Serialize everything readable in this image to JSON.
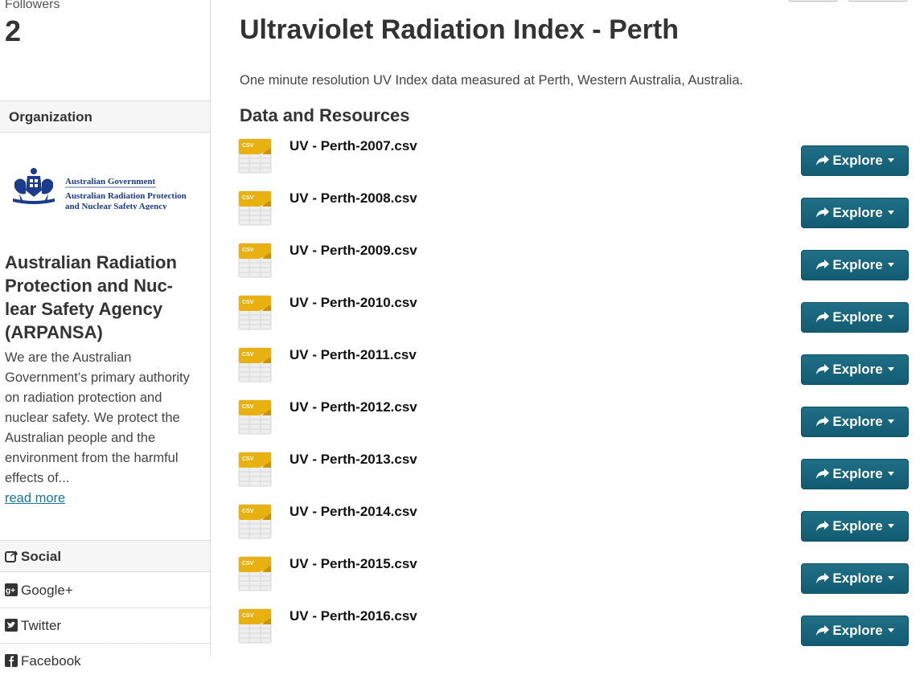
{
  "sidebar": {
    "followers": {
      "label": "Followers",
      "count": "2"
    },
    "organization": {
      "heading": "Organization",
      "logo_text": [
        "Australian Government",
        "Australian Radiation Protection",
        "and Nuclear Safety Agency"
      ],
      "name": "Australian Radiation Protection and Nuc-lear Safety Agency (ARPANSA)",
      "description": "We are the Australian Government’s primary authority on radiation protection and nuclear safety. We protect the Australian people and the environment from the harmful effects of...",
      "read_more": "read more"
    },
    "social": {
      "heading": "Social",
      "items": [
        {
          "label": "Google+",
          "icon": "google-plus-icon"
        },
        {
          "label": "Twitter",
          "icon": "twitter-icon"
        },
        {
          "label": "Facebook",
          "icon": "facebook-icon"
        }
      ]
    }
  },
  "main": {
    "title": "Ultraviolet Radiation Index - Perth",
    "notes": "One minute resolution UV Index data measured at Perth, Western Australia, Australia.",
    "resources_heading": "Data and Resources",
    "explore_label": "Explore",
    "resources": [
      {
        "name": "UV - Perth-2007.csv",
        "format": "CSV"
      },
      {
        "name": "UV - Perth-2008.csv",
        "format": "CSV"
      },
      {
        "name": "UV - Perth-2009.csv",
        "format": "CSV"
      },
      {
        "name": "UV - Perth-2010.csv",
        "format": "CSV"
      },
      {
        "name": "UV - Perth-2011.csv",
        "format": "CSV"
      },
      {
        "name": "UV - Perth-2012.csv",
        "format": "CSV"
      },
      {
        "name": "UV - Perth-2013.csv",
        "format": "CSV"
      },
      {
        "name": "UV - Perth-2014.csv",
        "format": "CSV"
      },
      {
        "name": "UV - Perth-2015.csv",
        "format": "CSV"
      },
      {
        "name": "UV - Perth-2016.csv",
        "format": "CSV"
      }
    ]
  },
  "colors": {
    "button": "#1a6a82",
    "link": "#187794",
    "csv_icon": "#e9b10f",
    "logo_blue": "#1d3b8b"
  }
}
